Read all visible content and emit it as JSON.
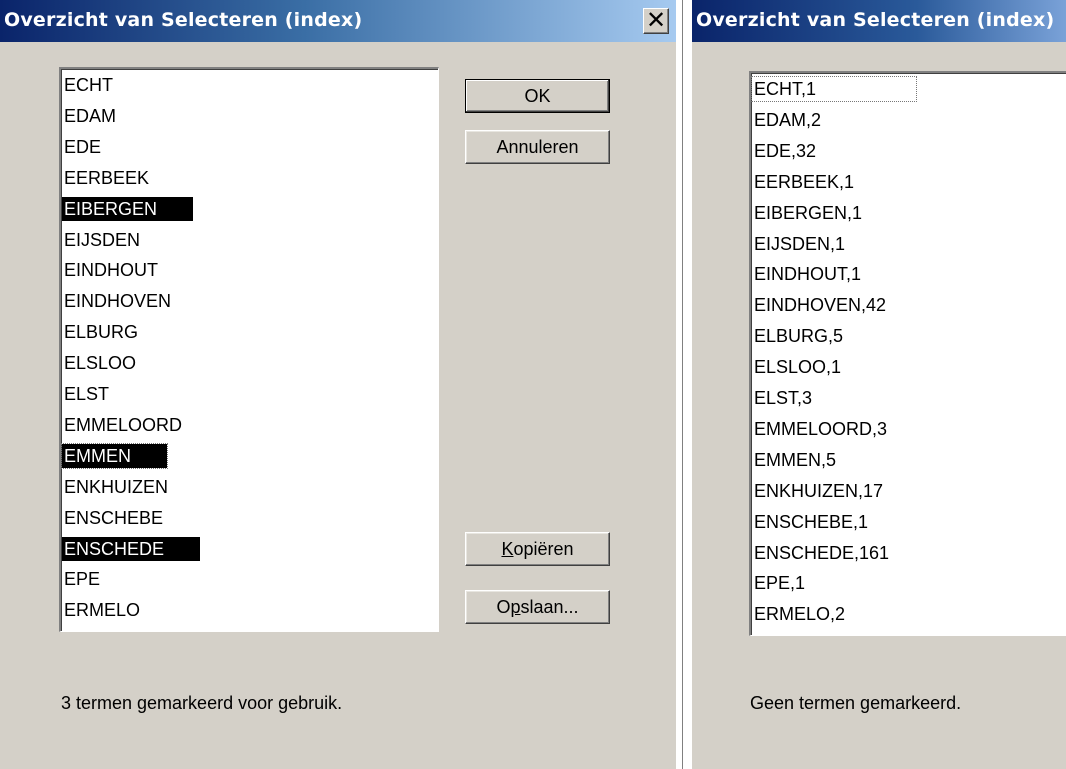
{
  "left_dialog": {
    "title": "Overzicht van  Selecteren (index)",
    "close_glyph": "✕",
    "items": [
      {
        "label": "ECHT",
        "selected": false
      },
      {
        "label": "EDAM",
        "selected": false
      },
      {
        "label": "EDE",
        "selected": false
      },
      {
        "label": "EERBEEK",
        "selected": false
      },
      {
        "label": "EIBERGEN",
        "selected": true
      },
      {
        "label": "EIJSDEN",
        "selected": false
      },
      {
        "label": "EINDHOUT",
        "selected": false
      },
      {
        "label": "EINDHOVEN",
        "selected": false
      },
      {
        "label": "ELBURG",
        "selected": false
      },
      {
        "label": "ELSLOO",
        "selected": false
      },
      {
        "label": "ELST",
        "selected": false
      },
      {
        "label": "EMMELOORD",
        "selected": false
      },
      {
        "label": "EMMEN",
        "selected": true
      },
      {
        "label": "ENKHUIZEN",
        "selected": false
      },
      {
        "label": "ENSCHEBE",
        "selected": false
      },
      {
        "label": "ENSCHEDE",
        "selected": true
      },
      {
        "label": "EPE",
        "selected": false
      },
      {
        "label": "ERMELO",
        "selected": false
      }
    ],
    "buttons": {
      "ok": "OK",
      "cancel": "Annuleren",
      "copy_mnemonic": "K",
      "copy_rest": "opiëren",
      "save_pre": "O",
      "save_mnemonic": "p",
      "save_rest": "slaan..."
    },
    "status": "3 termen gemarkeerd voor gebruik."
  },
  "right_dialog": {
    "title": "Overzicht van  Selecteren (index)",
    "items": [
      "ECHT,1",
      "EDAM,2",
      "EDE,32",
      "EERBEEK,1",
      "EIBERGEN,1",
      "EIJSDEN,1",
      "EINDHOUT,1",
      "EINDHOVEN,42",
      "ELBURG,5",
      "ELSLOO,1",
      "ELST,3",
      "EMMELOORD,3",
      "EMMEN,5",
      "ENKHUIZEN,17",
      "ENSCHEBE,1",
      "ENSCHEDE,161",
      "EPE,1",
      "ERMELO,2"
    ],
    "status": "Geen termen gemarkeerd."
  }
}
